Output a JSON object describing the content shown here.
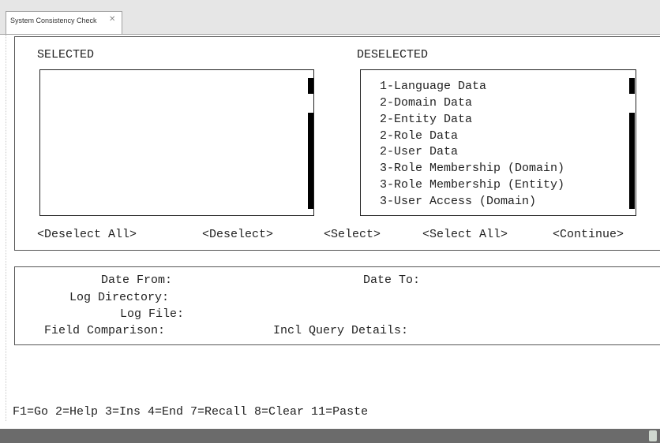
{
  "tab": {
    "label": "System Consistency Check",
    "close": "✕"
  },
  "selected": {
    "header": "SELECTED",
    "items": []
  },
  "deselected": {
    "header": "DESELECTED",
    "items": [
      "1-Language Data",
      "2-Domain Data",
      "2-Entity Data",
      "2-Role Data",
      "2-User Data",
      "3-Role Membership (Domain)",
      "3-Role Membership (Entity)",
      "3-User Access (Domain)"
    ]
  },
  "buttons": {
    "deselect_all": "<Deselect All>",
    "deselect": "<Deselect>",
    "select": "<Select>",
    "select_all": "<Select All>",
    "continue": "<Continue>"
  },
  "fields": {
    "date_from": "Date From:",
    "date_to": "Date To:",
    "log_directory": "Log Directory:",
    "log_file": "Log File:",
    "field_comparison": "Field Comparison:",
    "incl_query_details": "Incl Query Details:"
  },
  "function_keys": "F1=Go 2=Help 3=Ins 4=End 7=Recall 8=Clear 11=Paste"
}
